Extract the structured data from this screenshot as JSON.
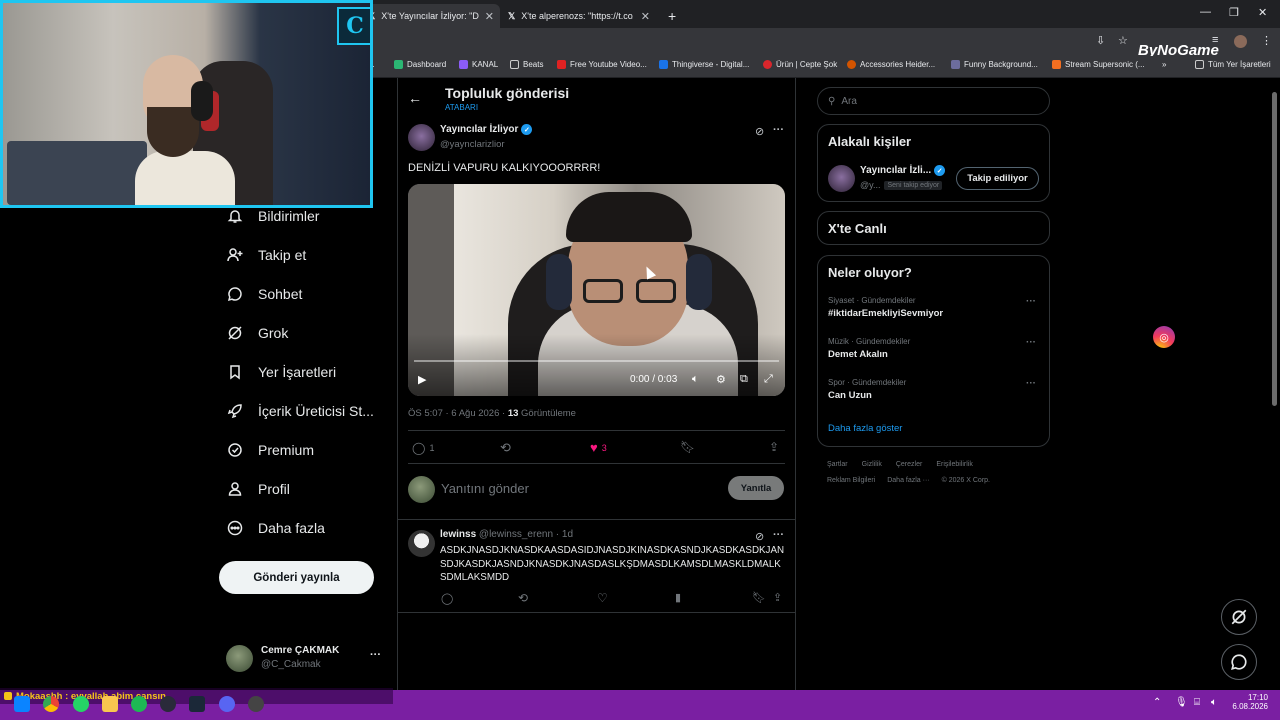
{
  "browser": {
    "tabs": [
      {
        "label": "X'te Yayıncılar İzliyor: \"DENİZLİ",
        "active": true
      },
      {
        "label": "X'te alperenozs: \"https://t.co/H",
        "active": false
      }
    ],
    "new_tab": "+",
    "bookmarks": [
      "c...",
      "Dashboard",
      "KANAL",
      "Beats",
      "Free Youtube Video...",
      "Thingiverse - Digital...",
      "Ürün | Cepte Şok",
      "Accessories Heider...",
      "Funny Background...",
      "Stream Supersonic (...",
      "Tüm Yer İşaretleri"
    ],
    "bynogame": "ByNoGame"
  },
  "webcam": {
    "logo": "C"
  },
  "nav": {
    "items": [
      {
        "label": "Bildirimler",
        "icon": "bell-icon"
      },
      {
        "label": "Takip et",
        "icon": "follow-icon"
      },
      {
        "label": "Sohbet",
        "icon": "chat-icon"
      },
      {
        "label": "Grok",
        "icon": "grok-icon"
      },
      {
        "label": "Yer İşaretleri",
        "icon": "bookmark-icon"
      },
      {
        "label": "İçerik Üreticisi St...",
        "icon": "rocket-icon"
      },
      {
        "label": "Premium",
        "icon": "premium-icon"
      },
      {
        "label": "Profil",
        "icon": "profile-icon"
      },
      {
        "label": "Daha fazla",
        "icon": "more-icon"
      }
    ],
    "post_button": "Gönderi yayınla",
    "account": {
      "name": "Cemre ÇAKMAK",
      "handle": "@C_Cakmak",
      "more": "···"
    }
  },
  "post": {
    "header_title": "Topluluk gönderisi",
    "header_sub": "ATABARI",
    "author": "Yayıncılar İzliyor",
    "handle": "@yaynclarizlior",
    "text": "DENİZLİ VAPURU KALKIYOOORRRR!",
    "video_time": "0:00 / 0:03",
    "video_progress": 0.0,
    "timestamp": "ÖS 5:07 · 6 Ağu 2026 · ",
    "views_count": "13",
    "views_label": " Görüntüleme",
    "replies": "1",
    "likes": "3",
    "reply_placeholder": "Yanıtını gönder",
    "reply_button": "Yanıtla"
  },
  "reply": {
    "author": "lewinss",
    "handle": "@lewinss_erenn · 1d",
    "text": "ASDKJNASDJKNASDKAASDASIDJNASDJKINASDKASNDJKASDKASDKJANSDJKASDKJASNDJKNASDKJNASDASLKŞDMASDLKAMSDLMASKLDMALKSDMLAKSMDD"
  },
  "search": {
    "placeholder": "Ara"
  },
  "related": {
    "title": "Alakalı kişiler",
    "name": "Yayıncılar İzli...",
    "handle": "@y...",
    "follows_you": "Seni takip ediyor",
    "follow_button": "Takip ediliyor"
  },
  "live": {
    "title": "X'te Canlı"
  },
  "trends": {
    "title": "Neler oluyor?",
    "items": [
      {
        "category": "Siyaset · Gündemdekiler",
        "name": "#iktidarEmekliyiSevmiyor"
      },
      {
        "category": "Müzik · Gündemdekiler",
        "name": "Demet Akalın"
      },
      {
        "category": "Spor · Gündemdekiler",
        "name": "Can Uzun"
      }
    ],
    "show_more": "Daha fazla göster"
  },
  "footer": {
    "line1": [
      "Şartlar",
      "Gizlilik",
      "Çerezler",
      "Erişilebilirlik"
    ],
    "line2": [
      "Reklam Bilgileri",
      "Daha fazla ···",
      "© 2026 X Corp."
    ]
  },
  "taskbar": {
    "chat": "Mokaashh : eyvallah abim cansın",
    "time": "17:10",
    "date": "6.08.2026"
  },
  "colors": {
    "accent": "#1d9bf0",
    "like": "#f91880",
    "taskbar": "#7a1fa2",
    "webcam_border": "#1fc6f1"
  }
}
